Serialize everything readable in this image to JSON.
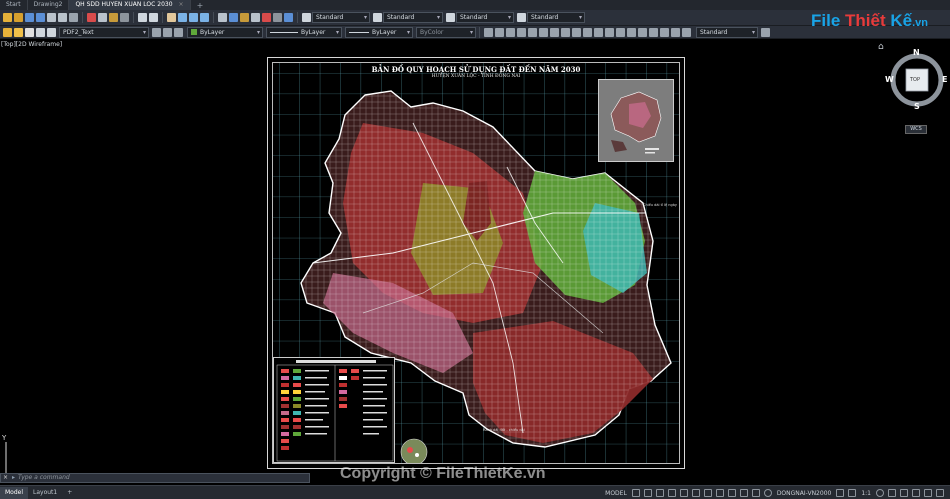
{
  "tabs": [
    {
      "label": "Start",
      "active": false
    },
    {
      "label": "Drawing2",
      "active": false
    },
    {
      "label": "QH SDD HUYEN XUAN LOC 2030",
      "active": true
    }
  ],
  "tab_close_glyph": "×",
  "tab_add_glyph": "+",
  "toolbar": {
    "text_style_1": "Standard",
    "text_style_2": "Standard",
    "text_style_3": "Standard",
    "text_style_4": "Standard",
    "layer": "PDF2_Text",
    "color": "ByLayer",
    "linetype": "ByLayer",
    "lineweight": "ByLayer",
    "plotstyle": "ByColor",
    "multileader_style": "Standard"
  },
  "logo": {
    "part1": "File",
    "part2": "Thiết",
    "part3": "Kế",
    "part4": ".vn"
  },
  "viewport": {
    "label": "[Top][2D Wireframe]",
    "map_title": "BẢN ĐỒ QUY HOẠCH SỬ DỤNG ĐẤT ĐẾN NĂM 2030",
    "map_subtitle": "HUYỆN XUÂN LỘC - TỈNH ĐỒNG NAI",
    "annotation_east": "Chiều dài tỉ lệ ngày",
    "annotation_south": "Ranh dải đất - chiều dài"
  },
  "navcube": {
    "north": "N",
    "south": "S",
    "east": "E",
    "west": "W",
    "face": "TOP",
    "wcs": "WCS"
  },
  "ucs_y": "Y",
  "watermark": "Copyright © FileThietKe.vn",
  "command": {
    "close_glyph": "×",
    "prompt_glyph": "▸",
    "placeholder": "Type a command"
  },
  "status": {
    "layouts": [
      {
        "label": "Model",
        "active": true
      },
      {
        "label": "Layout1",
        "active": false
      }
    ],
    "add_layout": "+",
    "mode": "MODEL",
    "coord_system": "DONGNAI-VN2000",
    "scale": "1:1"
  },
  "colors": {
    "background": "#000000",
    "grid": "#6fc6d6",
    "boundary": "#ffffff",
    "land_red": "#8c2a2a",
    "land_green": "#5fa83a",
    "land_cyan": "#3fb6b0",
    "accent": "#19a3e6"
  }
}
